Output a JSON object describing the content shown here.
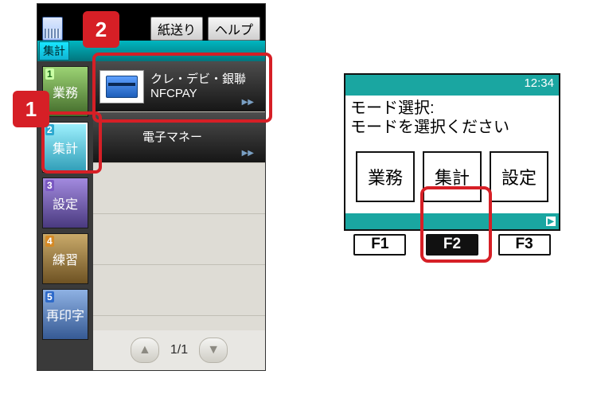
{
  "left": {
    "topButtons": {
      "feed": "紙送り",
      "help": "ヘルプ"
    },
    "modeTag": "集計",
    "sidetabs": [
      {
        "num": "1",
        "label": "業務"
      },
      {
        "num": "2",
        "label": "集計"
      },
      {
        "num": "3",
        "label": "設定"
      },
      {
        "num": "4",
        "label": "練習"
      },
      {
        "num": "5",
        "label": "再印字"
      }
    ],
    "rows": [
      {
        "line1": "クレ・デビ・銀聯",
        "line2": "NFCPAY"
      },
      {
        "line1": "電子マネー"
      }
    ],
    "pager": "1/1",
    "callouts": {
      "c1": "1",
      "c2": "2"
    }
  },
  "right": {
    "clock": "12:34",
    "msg1": "モード選択:",
    "msg2": "モードを選択ください",
    "modes": [
      "業務",
      "集計",
      "設定"
    ],
    "fkeys": [
      "F1",
      "F2",
      "F3"
    ]
  }
}
